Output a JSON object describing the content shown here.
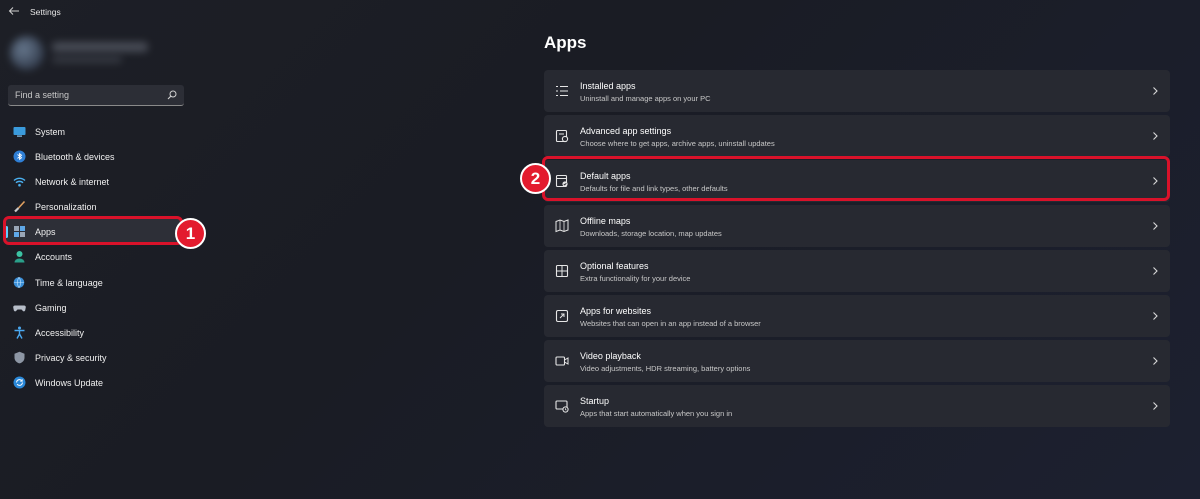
{
  "window": {
    "title": "Settings"
  },
  "search": {
    "placeholder": "Find a setting"
  },
  "sidebar": {
    "items": [
      {
        "label": "System",
        "icon": "system-icon"
      },
      {
        "label": "Bluetooth & devices",
        "icon": "bluetooth-icon"
      },
      {
        "label": "Network & internet",
        "icon": "wifi-icon"
      },
      {
        "label": "Personalization",
        "icon": "brush-icon"
      },
      {
        "label": "Apps",
        "icon": "apps-icon",
        "selected": true
      },
      {
        "label": "Accounts",
        "icon": "person-icon"
      },
      {
        "label": "Time & language",
        "icon": "globe-clock-icon"
      },
      {
        "label": "Gaming",
        "icon": "gamepad-icon"
      },
      {
        "label": "Accessibility",
        "icon": "accessibility-icon"
      },
      {
        "label": "Privacy & security",
        "icon": "shield-icon"
      },
      {
        "label": "Windows Update",
        "icon": "update-icon"
      }
    ]
  },
  "main": {
    "title": "Apps",
    "cards": [
      {
        "title": "Installed apps",
        "desc": "Uninstall and manage apps on your PC",
        "icon": "list-icon"
      },
      {
        "title": "Advanced app settings",
        "desc": "Choose where to get apps, archive apps, uninstall updates",
        "icon": "app-settings-icon"
      },
      {
        "title": "Default apps",
        "desc": "Defaults for file and link types, other defaults",
        "icon": "default-apps-icon"
      },
      {
        "title": "Offline maps",
        "desc": "Downloads, storage location, map updates",
        "icon": "map-icon"
      },
      {
        "title": "Optional features",
        "desc": "Extra functionality for your device",
        "icon": "optional-features-icon"
      },
      {
        "title": "Apps for websites",
        "desc": "Websites that can open in an app instead of a browser",
        "icon": "link-app-icon"
      },
      {
        "title": "Video playback",
        "desc": "Video adjustments, HDR streaming, battery options",
        "icon": "video-icon"
      },
      {
        "title": "Startup",
        "desc": "Apps that start automatically when you sign in",
        "icon": "startup-icon"
      }
    ]
  },
  "annotations": {
    "step1": "1",
    "step2": "2"
  },
  "colors": {
    "accent": "#60cdff",
    "highlight": "#d9122a",
    "card_bg": "#272931"
  }
}
